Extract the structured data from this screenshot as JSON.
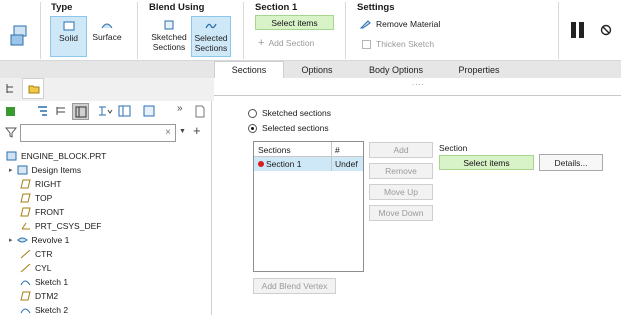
{
  "ribbon": {
    "type_group": {
      "label": "Type",
      "solid": "Solid",
      "surface": "Surface"
    },
    "blend_group": {
      "label": "Blend Using",
      "sketched": "Sketched Sections",
      "sketched_l1": "Sketched",
      "sketched_l2": "Sections",
      "selected_l1": "Selected",
      "selected_l2": "Sections"
    },
    "section_group": {
      "label": "Section 1",
      "select_items": "Select items",
      "add_section": "Add Section"
    },
    "settings_group": {
      "label": "Settings",
      "remove_material": "Remove Material",
      "thicken_sketch": "Thicken Sketch"
    }
  },
  "tabs": [
    "Sections",
    "Options",
    "Body Options",
    "Properties"
  ],
  "panel": {
    "radio_sketched": "Sketched sections",
    "radio_selected": "Selected sections",
    "table_headers": [
      "Sections",
      "#"
    ],
    "rows": [
      {
        "name": "Section 1",
        "num": "Undef"
      }
    ],
    "buttons": {
      "add": "Add",
      "remove": "Remove",
      "move_up": "Move Up",
      "move_down": "Move Down"
    },
    "section_label": "Section",
    "select_items": "Select items",
    "details": "Details...",
    "add_blend_vertex": "Add Blend Vertex",
    "ellipsis": "...."
  },
  "tree": {
    "root": "ENGINE_BLOCK.PRT",
    "items": [
      "Design Items",
      "RIGHT",
      "TOP",
      "FRONT",
      "PRT_CSYS_DEF",
      "Revolve 1",
      "CTR",
      "CYL",
      "Sketch 1",
      "DTM2",
      "Sketch 2"
    ]
  },
  "colors": {
    "accent_selected": "#cfe8f7",
    "select_green": "#d9f3c9",
    "red_dot": "#d81e1e"
  }
}
